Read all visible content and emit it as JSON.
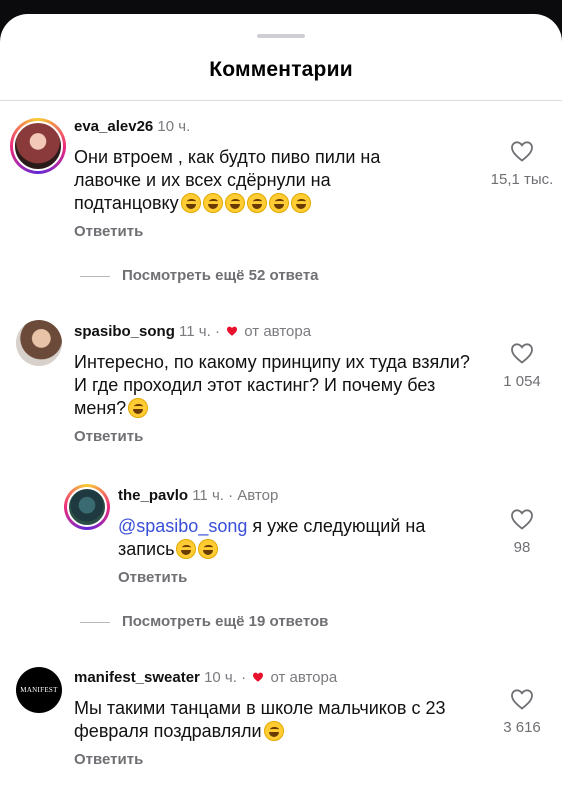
{
  "header": {
    "title": "Комментарии"
  },
  "comments": [
    {
      "user": "eva_alev26",
      "time": "10 ч.",
      "extra": "",
      "text": "Они втроем , как будто пиво пили на лавочке и их всех сдёрнули на подтанцовку",
      "likes": "15,1 тыс.",
      "reply": "Ответить",
      "more_replies": "Посмотреть ещё 52 ответа"
    },
    {
      "user": "spasibo_song",
      "time": "11 ч.",
      "extra": "от автора",
      "text": "Интересно, по какому принципу их туда взяли? И где проходил этот кастинг? И почему без меня?",
      "likes": "1 054",
      "reply": "Ответить"
    },
    {
      "user": "the_pavlo",
      "time": "11 ч.",
      "extra": "Автор",
      "mention": "@spasibo_song",
      "text": " я уже следующий на запись",
      "likes": "98",
      "reply": "Ответить",
      "more_replies": "Посмотреть ещё 19 ответов"
    },
    {
      "user": "manifest_sweater",
      "time": "10 ч.",
      "extra": "от автора",
      "avatar_text": "MANIFEST",
      "text": "Мы такими танцами в школе мальчиков с 23 февраля поздравляли",
      "likes": "3 616",
      "reply": "Ответить"
    }
  ],
  "separators": {
    "dot": "·"
  },
  "colors": {
    "mention": "#3a4fd8",
    "heart_red": "#e8112d",
    "muted": "#6f6f74"
  }
}
